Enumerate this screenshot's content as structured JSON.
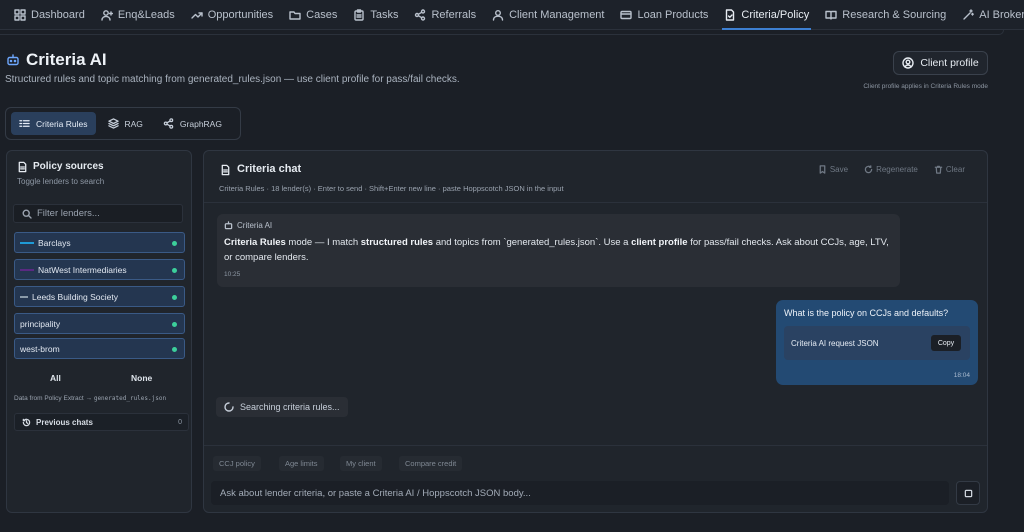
{
  "nav": {
    "items": [
      {
        "label": "Dashboard",
        "icon": "dashboard-icon"
      },
      {
        "label": "Enq&Leads",
        "icon": "user-plus-icon"
      },
      {
        "label": "Opportunities",
        "icon": "trend-up-icon"
      },
      {
        "label": "Cases",
        "icon": "folder-icon"
      },
      {
        "label": "Tasks",
        "icon": "clipboard-icon"
      },
      {
        "label": "Referrals",
        "icon": "share-icon"
      },
      {
        "label": "Client Management",
        "icon": "user-icon"
      },
      {
        "label": "Loan Products",
        "icon": "card-icon"
      },
      {
        "label": "Criteria/Policy",
        "icon": "doc-check-icon",
        "active": true
      },
      {
        "label": "Research & Sourcing",
        "icon": "book-icon"
      },
      {
        "label": "AI Broker Copilot",
        "icon": "wand-icon"
      }
    ]
  },
  "page": {
    "title": "Criteria AI",
    "subtitle": "Structured rules and topic matching from generated_rules.json — use client profile for pass/fail checks.",
    "profile_button": "Client profile",
    "profile_note": "Client profile applies in Criteria Rules mode"
  },
  "modes": {
    "items": [
      {
        "label": "Criteria Rules",
        "active": true
      },
      {
        "label": "RAG"
      },
      {
        "label": "GraphRAG"
      }
    ]
  },
  "sidebar": {
    "title": "Policy sources",
    "subtitle": "Toggle lenders to search",
    "filter_placeholder": "Filter lenders...",
    "lenders": [
      {
        "label": "Barclays",
        "logo_color": "#1f9ad6"
      },
      {
        "label": "NatWest Intermediaries",
        "logo_color": "#5a2a82"
      },
      {
        "label": "Leeds Building Society",
        "logo_color": "#8a9aa8"
      },
      {
        "label": "principality",
        "logo_color": ""
      },
      {
        "label": "west-brom",
        "logo_color": ""
      }
    ],
    "all_label": "All",
    "none_label": "None",
    "source_note_prefix": "Data from Policy Extract → ",
    "source_note_file": "generated_rules.json",
    "previous_chats_label": "Previous chats",
    "previous_chats_count": "0"
  },
  "chat": {
    "title": "Criteria chat",
    "save_label": "Save",
    "regenerate_label": "Regenerate",
    "clear_label": "Clear",
    "meta": "Criteria Rules · 18 lender(s) · Enter to send · Shift+Enter new line · paste Hoppscotch JSON in the input",
    "bot": {
      "name": "Criteria AI",
      "t1": "Criteria Rules",
      "t2": " mode — I match ",
      "t3": "structured rules",
      "t4": " and topics from `generated_rules.json`. Use a ",
      "t5": "client profile",
      "t6": " for pass/fail checks. Ask about CCJs, age, LTV, or compare lenders.",
      "time": "10:25"
    },
    "user": {
      "text": "What is the policy on CCJs and defaults?",
      "card_label": "Criteria AI request JSON",
      "copy_label": "Copy",
      "time": "18:04"
    },
    "searching": "Searching criteria rules...",
    "chips": [
      "CCJ policy",
      "Age limits",
      "My client",
      "Compare credit"
    ],
    "input_placeholder": "Ask about lender criteria, or paste a Criteria AI / Hoppscotch JSON body..."
  },
  "colors": {
    "accent": "#3d7fd1",
    "status_green": "#3ccf9b",
    "user_bubble": "#234a73"
  }
}
